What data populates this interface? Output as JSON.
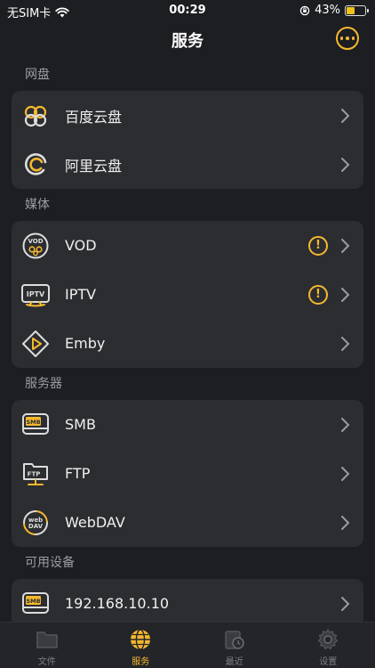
{
  "status_bar": {
    "carrier": "无SIM卡",
    "time": "00:29",
    "battery_percent": "43%",
    "battery_level": 0.43
  },
  "nav": {
    "title": "服务"
  },
  "sections": [
    {
      "title": "网盘",
      "items": [
        {
          "label": "百度云盘",
          "icon": "baidu-pan-icon"
        },
        {
          "label": "阿里云盘",
          "icon": "aliyun-pan-icon"
        }
      ]
    },
    {
      "title": "媒体",
      "items": [
        {
          "label": "VOD",
          "icon": "vod-icon",
          "warning": true
        },
        {
          "label": "IPTV",
          "icon": "iptv-icon",
          "warning": true
        },
        {
          "label": "Emby",
          "icon": "emby-icon"
        }
      ]
    },
    {
      "title": "服务器",
      "items": [
        {
          "label": "SMB",
          "icon": "smb-icon"
        },
        {
          "label": "FTP",
          "icon": "ftp-icon"
        },
        {
          "label": "WebDAV",
          "icon": "webdav-icon"
        }
      ]
    },
    {
      "title": "可用设备",
      "items": [
        {
          "label": "192.168.10.10",
          "icon": "smb-device-icon"
        }
      ]
    }
  ],
  "icon_text": {
    "vod": "VOD",
    "iptv": "IPTV",
    "smb": "SMB",
    "ftp": "FTP",
    "webdav_top": "web",
    "webdav_bottom": "DAV"
  },
  "warning_glyph": "!",
  "tabs": [
    {
      "label": "文件",
      "icon": "folder-icon",
      "active": false
    },
    {
      "label": "服务",
      "icon": "globe-icon",
      "active": true
    },
    {
      "label": "最近",
      "icon": "recent-icon",
      "active": false
    },
    {
      "label": "设置",
      "icon": "gear-icon",
      "active": false
    }
  ],
  "colors": {
    "accent": "#f5b82e",
    "background": "#1c1e22",
    "card": "#2b2d31"
  }
}
